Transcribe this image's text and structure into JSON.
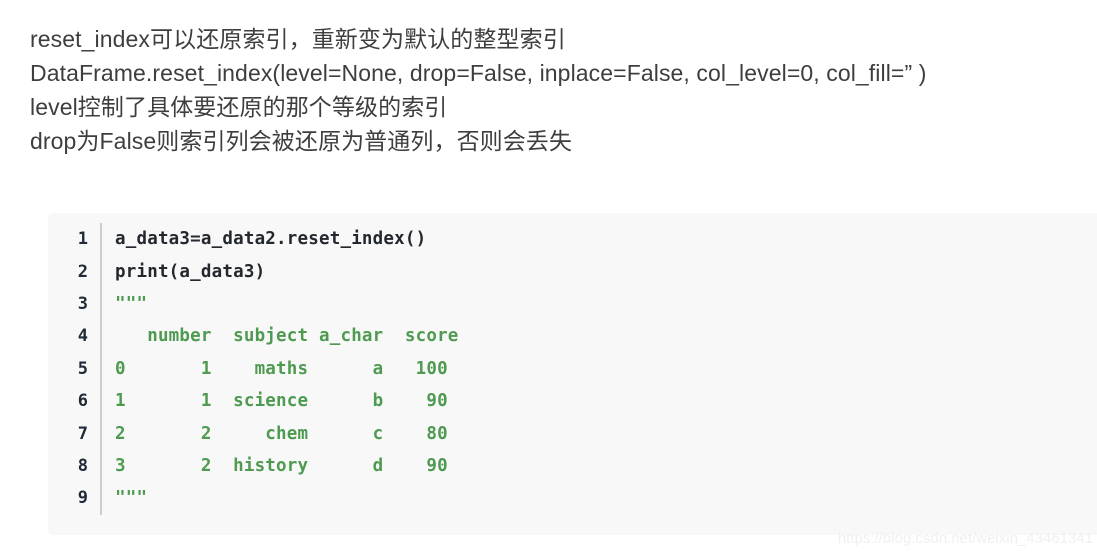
{
  "prose": {
    "lines": [
      "reset_index可以还原索引，重新变为默认的整型索引",
      "DataFrame.reset_index(level=None, drop=False, inplace=False, col_level=0, col_fill=” )",
      "level控制了具体要还原的那个等级的索引",
      "drop为False则索引列会被还原为普通列，否则会丢失"
    ]
  },
  "code_block": {
    "language": "python",
    "colors": {
      "background": "#f8f8f8",
      "gutter_text": "#1f2937",
      "gutter_rule": "#cdcdcd",
      "plain_text": "#23272e",
      "string_text": "#4e9a51"
    },
    "lines": [
      {
        "number": "1",
        "text": "a_data3=a_data2.reset_index()",
        "token": "plain"
      },
      {
        "number": "2",
        "text": "print(a_data3)",
        "token": "plain"
      },
      {
        "number": "3",
        "text": "\"\"\"",
        "token": "string"
      },
      {
        "number": "4",
        "text": "   number  subject a_char  score",
        "token": "string"
      },
      {
        "number": "5",
        "text": "0       1    maths      a   100",
        "token": "string"
      },
      {
        "number": "6",
        "text": "1       1  science      b    90",
        "token": "string"
      },
      {
        "number": "7",
        "text": "2       2     chem      c    80",
        "token": "string"
      },
      {
        "number": "8",
        "text": "3       2  history      d    90",
        "token": "string"
      },
      {
        "number": "9",
        "text": "\"\"\"",
        "token": "string"
      }
    ]
  },
  "watermark": {
    "text": "https://blog.csdn.net/weixin_43461341"
  },
  "printed_table": {
    "columns": [
      "",
      "number",
      "subject",
      "a_char",
      "score"
    ],
    "rows": [
      [
        "0",
        "1",
        "maths",
        "a",
        "100"
      ],
      [
        "1",
        "1",
        "science",
        "b",
        "90"
      ],
      [
        "2",
        "2",
        "chem",
        "c",
        "80"
      ],
      [
        "3",
        "2",
        "history",
        "d",
        "90"
      ]
    ]
  }
}
